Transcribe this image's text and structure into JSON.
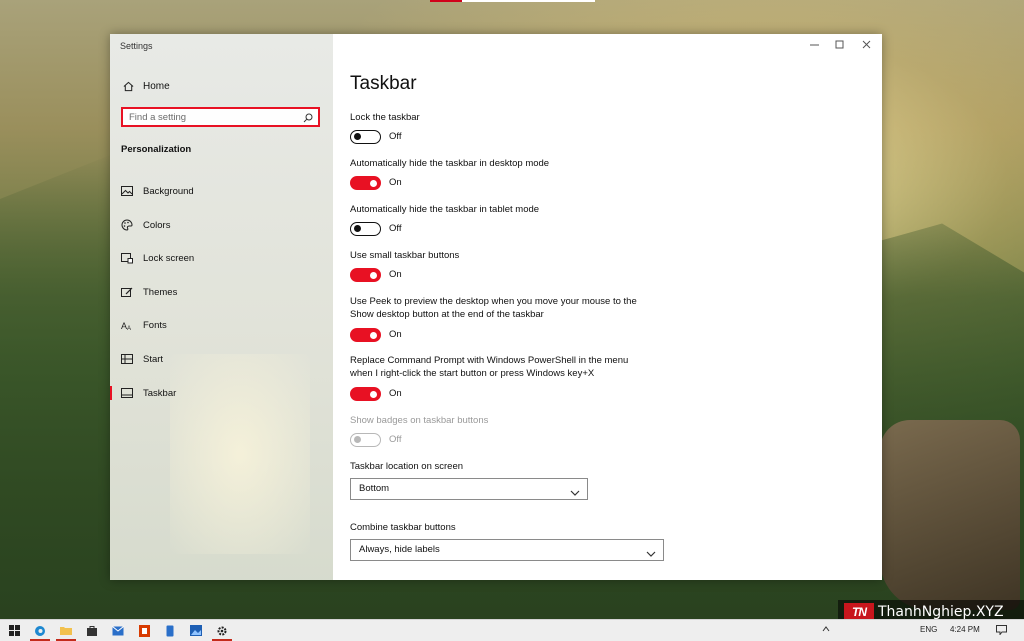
{
  "window": {
    "title": "Settings",
    "controls": {
      "minimize": "—",
      "maximize": "☐",
      "close": "✕"
    }
  },
  "nav": {
    "home_label": "Home",
    "search_placeholder": "Find a setting",
    "section_title": "Personalization",
    "items": [
      {
        "label": "Background",
        "icon": "image-icon"
      },
      {
        "label": "Colors",
        "icon": "palette-icon"
      },
      {
        "label": "Lock screen",
        "icon": "lock-screen-icon"
      },
      {
        "label": "Themes",
        "icon": "themes-icon"
      },
      {
        "label": "Fonts",
        "icon": "fonts-icon"
      },
      {
        "label": "Start",
        "icon": "start-icon"
      },
      {
        "label": "Taskbar",
        "icon": "taskbar-icon",
        "active": true
      }
    ]
  },
  "page": {
    "title": "Taskbar",
    "settings": [
      {
        "label": "Lock the taskbar",
        "state": "Off"
      },
      {
        "label": "Automatically hide the taskbar in desktop mode",
        "state": "On"
      },
      {
        "label": "Automatically hide the taskbar in tablet mode",
        "state": "Off"
      },
      {
        "label": "Use small taskbar buttons",
        "state": "On"
      },
      {
        "label_line1": "Use Peek to preview the desktop when you move your mouse to the",
        "label_line2": "Show desktop button at the end of the taskbar",
        "state": "On"
      },
      {
        "label_line1": "Replace Command Prompt with Windows PowerShell in the menu",
        "label_line2": "when I right-click the start button or press Windows key+X",
        "state": "On"
      },
      {
        "label": "Show badges on taskbar buttons",
        "state": "Off",
        "disabled": true
      }
    ],
    "location": {
      "label": "Taskbar location on screen",
      "value": "Bottom"
    },
    "combine": {
      "label": "Combine taskbar buttons",
      "value": "Always, hide labels"
    }
  },
  "taskbar": {
    "apps": [
      "start-icon",
      "edge-icon",
      "file-explorer-icon",
      "store-icon",
      "mail-icon",
      "office-icon",
      "phone-icon",
      "photos-icon",
      "settings-icon"
    ],
    "tray": {
      "language": "ENG",
      "time": "4:24 PM"
    }
  },
  "watermark": {
    "logo": "TN",
    "text": "ThanhNghiep.XYZ"
  },
  "colors": {
    "accent": "#e81123"
  }
}
